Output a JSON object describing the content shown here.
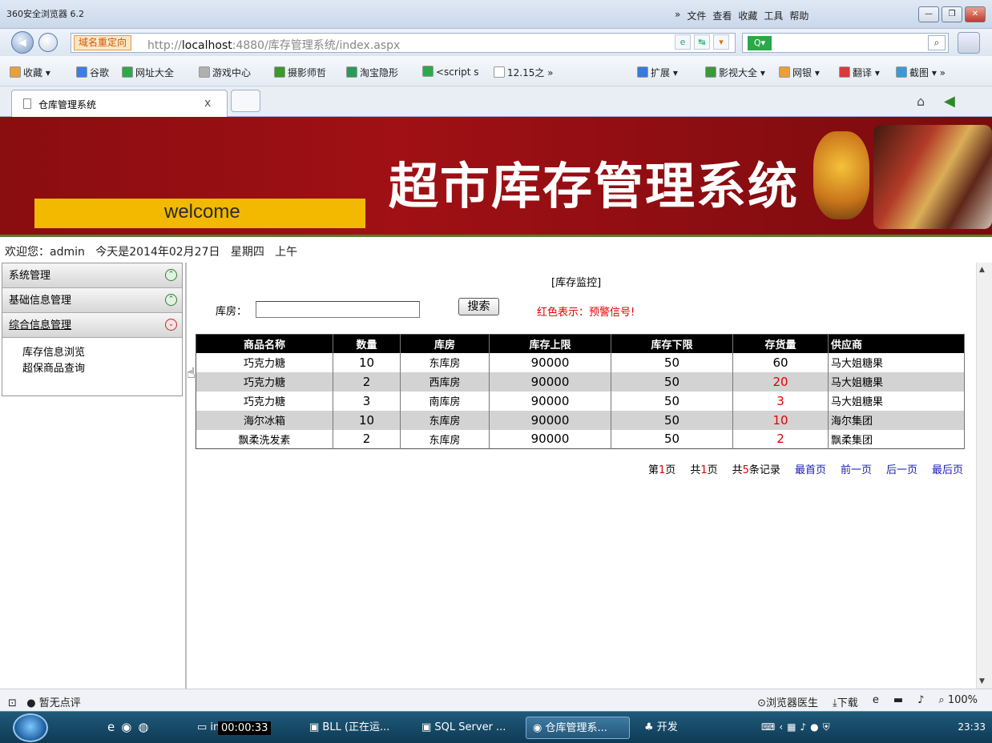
{
  "browser": {
    "app_title": "360安全浏览器 6.2",
    "menu": [
      "»",
      "文件",
      "查看",
      "收藏",
      "工具",
      "帮助"
    ],
    "url_tag": "域名重定向",
    "url_prefix": "http://",
    "url_host": "localhost",
    "url_rest": ":4880/库存管理系统/index.aspx",
    "favorites": [
      {
        "label": "收藏 ▾",
        "color": "#e9a03b"
      },
      {
        "label": "谷歌",
        "color": "#3b7de9"
      },
      {
        "label": "网址大全",
        "color": "#2fa84a"
      },
      {
        "label": "游戏中心",
        "color": "#b0b0b0"
      },
      {
        "label": "摄影师哲",
        "color": "#3a9a2a"
      },
      {
        "label": "淘宝隐形",
        "color": "#2a9a5a"
      },
      {
        "label": "<script s",
        "color": "#2fa84a"
      },
      {
        "label": "12.15之 »",
        "color": "#ffffff"
      },
      {
        "label": "扩展 ▾",
        "color": "#3a7ad9"
      },
      {
        "label": "影视大全 ▾",
        "color": "#3a9a3a"
      },
      {
        "label": "网银 ▾",
        "color": "#e9a03b"
      },
      {
        "label": "翻译 ▾",
        "color": "#d93a3a"
      },
      {
        "label": "截图 ▾ »",
        "color": "#3a9ad9"
      }
    ],
    "tab_title": "仓库管理系统",
    "tab_close": "x",
    "status_left": "暂无点评",
    "status_right": [
      "浏览器医生",
      "下载",
      "100%"
    ]
  },
  "header": {
    "welcome": "welcome",
    "title": "超市库存管理系统"
  },
  "status_line": "欢迎您：admin   今天是2014年02月27日   星期四   上午",
  "sidebar": {
    "groups": [
      {
        "label": "系统管理"
      },
      {
        "label": "基础信息管理"
      },
      {
        "label": "综合信息管理"
      }
    ],
    "sub_items": [
      "库存信息浏览",
      "超保商品查询"
    ]
  },
  "main": {
    "page_title": "[库存监控]",
    "filter_label": "库房：",
    "filter_value": "",
    "search_button": "搜索",
    "hint": "红色表示：预警信号!",
    "columns": [
      "商品名称",
      "数量",
      "库房",
      "库存上限",
      "库存下限",
      "存货量",
      "供应商"
    ],
    "rows": [
      {
        "name": "巧克力糖",
        "qty": "10",
        "store": "东库房",
        "upper": "90000",
        "lower": "50",
        "stock": "60",
        "supplier": "马大姐糖果"
      },
      {
        "name": "巧克力糖",
        "qty": "2",
        "store": "西库房",
        "upper": "90000",
        "lower": "50",
        "stock": "20",
        "supplier": "马大姐糖果"
      },
      {
        "name": "巧克力糖",
        "qty": "3",
        "store": "南库房",
        "upper": "90000",
        "lower": "50",
        "stock": "3",
        "supplier": "马大姐糖果"
      },
      {
        "name": "海尔冰箱",
        "qty": "10",
        "store": "东库房",
        "upper": "90000",
        "lower": "50",
        "stock": "10",
        "supplier": "海尔集团"
      },
      {
        "name": "飘柔洗发素",
        "qty": "2",
        "store": "东库房",
        "upper": "90000",
        "lower": "50",
        "stock": "2",
        "supplier": "飘柔集团"
      }
    ],
    "pager": {
      "page_prefix": "第",
      "page_num": "1",
      "page_suffix": "页",
      "total_prefix": "共",
      "total_num": "1",
      "total_suffix": "页",
      "records_prefix": "共",
      "records_num": "5",
      "records_suffix": "条记录",
      "first": "最首页",
      "prev": "前一页",
      "next": "后一页",
      "last": "最后页"
    }
  },
  "taskbar": {
    "timer": "00:00:33",
    "tasks": [
      "image",
      "BLL (正在运...",
      "SQL Server ...",
      "仓库管理系...",
      "开发"
    ],
    "clock": "23:33"
  },
  "colors": {
    "banner": "#8a0d10",
    "welcome_bar": "#f3b800",
    "warning": "#e00000",
    "link": "#1a1ab8"
  }
}
